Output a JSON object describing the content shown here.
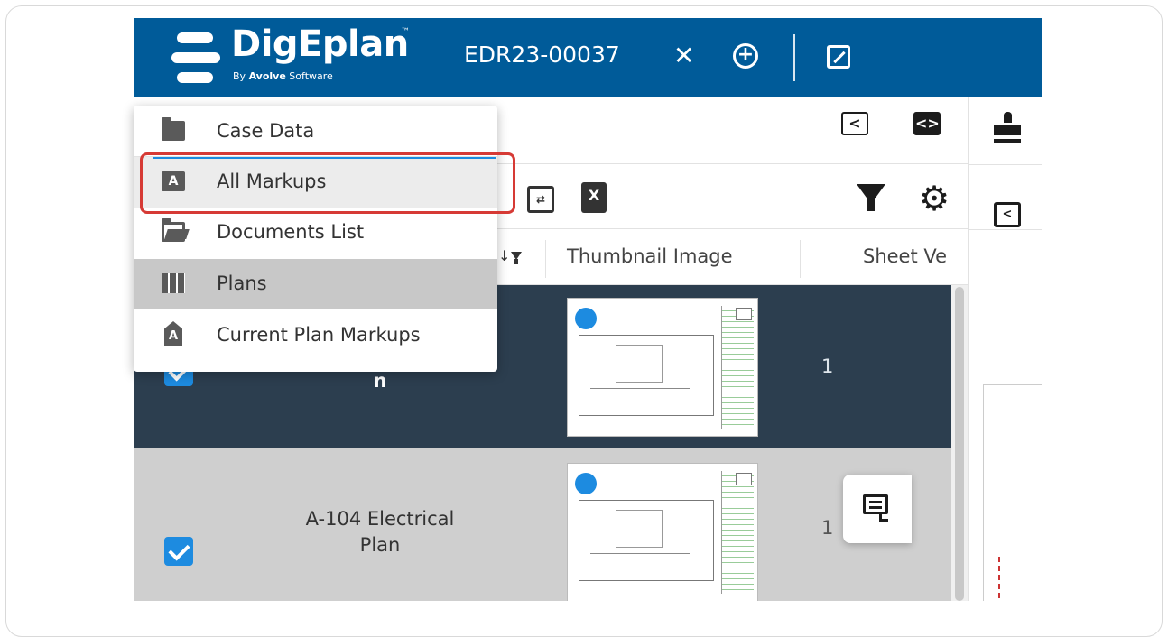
{
  "header": {
    "brand": "DigEplan",
    "trademark": "™",
    "byline_prefix": "By ",
    "byline_company": "Avolve",
    "byline_suffix": " Software",
    "case_id": "EDR23-00037",
    "close_glyph": "✕",
    "add_glyph": "+",
    "brand_color": "#005b99"
  },
  "toolbar": {
    "collapse_left_glyph": "<",
    "code_view_glyph": "<>",
    "icons": [
      "collapse-left-icon",
      "expand-code-icon",
      "compare-icon",
      "excel-export-icon",
      "filter-icon",
      "gear-icon"
    ]
  },
  "menu": {
    "items": [
      {
        "label": "Case Data",
        "icon": "folder-icon"
      },
      {
        "label": "All Markups",
        "icon": "markup-icon",
        "highlighted": true
      },
      {
        "label": "Documents List",
        "icon": "folder-open-icon"
      },
      {
        "label": "Plans",
        "icon": "map-icon",
        "active": true
      },
      {
        "label": "Current Plan Markups",
        "icon": "pencil-markup-icon"
      }
    ]
  },
  "table": {
    "columns": [
      "Thumbnail Image",
      "Sheet Ve"
    ],
    "rows": [
      {
        "name": "n",
        "sheet_version": "1",
        "checked": true,
        "selected": true
      },
      {
        "name": "A-104 Electrical Plan",
        "name_line1": "A-104 Electrical",
        "name_line2": "Plan",
        "sheet_version": "1",
        "checked": true,
        "selected": false
      }
    ]
  },
  "colors": {
    "selected_row": "#2c3e4f",
    "unselected_row": "#cfcfcf",
    "checkbox": "#1d8be0",
    "highlight": "#d63a35"
  }
}
